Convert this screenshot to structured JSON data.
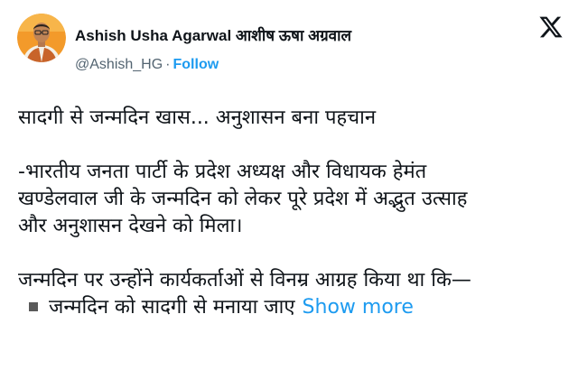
{
  "author": {
    "display_name": "Ashish Usha Agarwal आशीष ऊषा अग्रवाल",
    "handle": "@Ashish_HG",
    "separator": "·",
    "follow_label": "Follow",
    "avatar": "profile-photo"
  },
  "platform": {
    "logo_glyph": "𝕏",
    "logo_icon": "x-logo-icon"
  },
  "tweet": {
    "line1": "सादगी से जन्मदिन खास... अनुशासन बना पहचान",
    "para2_line1": "-भारतीय जनता पार्टी के प्रदेश अध्यक्ष और विधायक हेमंत",
    "para2_line2": "खण्डेलवाल जी के जन्मदिन को लेकर पूरे प्रदेश में अद्भुत उत्साह",
    "para2_line3": "और अनुशासन देखने को मिला।",
    "para3_line1": "जन्मदिन पर उन्होंने कार्यकर्ताओं से विनम्र आग्रह किया था कि—",
    "bullet1": "जन्मदिन को सादगी से मनाया जाए",
    "show_more": "Show more"
  },
  "colors": {
    "text": "#0f1419",
    "secondary": "#536471",
    "link": "#1d9bf0"
  }
}
